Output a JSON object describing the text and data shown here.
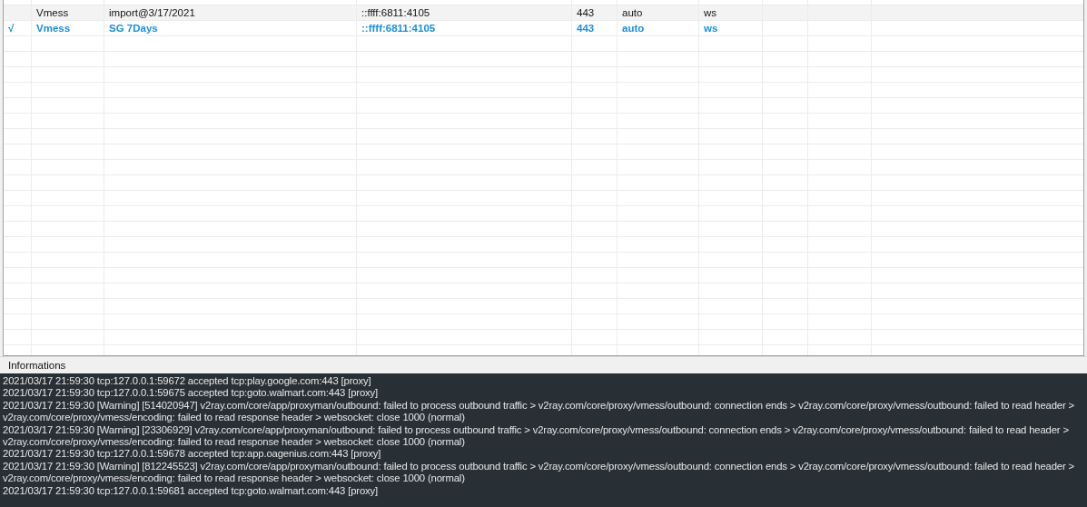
{
  "servers": {
    "rows": [
      {
        "selected": false,
        "hovered": true,
        "check": "",
        "type": "Vmess",
        "alias": "import@3/17/2021",
        "address": "::ffff:6811:4105",
        "port": "443",
        "security": "auto",
        "network": "ws"
      },
      {
        "selected": true,
        "hovered": false,
        "check": "√",
        "type": "Vmess",
        "alias": "SG 7Days",
        "address": "::ffff:6811:4105",
        "port": "443",
        "security": "auto",
        "network": "ws"
      }
    ]
  },
  "log_panel": {
    "title": "Informations",
    "entries": [
      "2021/03/17 21:59:30 tcp:127.0.0.1:59672 accepted tcp:play.google.com:443 [proxy]",
      "2021/03/17 21:59:30 tcp:127.0.0.1:59675 accepted tcp:goto.walmart.com:443 [proxy]",
      "2021/03/17 21:59:30 [Warning] [514020947] v2ray.com/core/app/proxyman/outbound: failed to process outbound traffic > v2ray.com/core/proxy/vmess/outbound: connection ends > v2ray.com/core/proxy/vmess/outbound: failed to read header > v2ray.com/core/proxy/vmess/encoding: failed to read response header > websocket: close 1000 (normal)",
      "2021/03/17 21:59:30 [Warning] [23306929] v2ray.com/core/app/proxyman/outbound: failed to process outbound traffic > v2ray.com/core/proxy/vmess/outbound: connection ends > v2ray.com/core/proxy/vmess/outbound: failed to read header > v2ray.com/core/proxy/vmess/encoding: failed to read response header > websocket: close 1000 (normal)",
      "2021/03/17 21:59:30 tcp:127.0.0.1:59678 accepted tcp:app.oagenius.com:443 [proxy]",
      "2021/03/17 21:59:30 [Warning] [812245523] v2ray.com/core/app/proxyman/outbound: failed to process outbound traffic > v2ray.com/core/proxy/vmess/outbound: connection ends > v2ray.com/core/proxy/vmess/outbound: failed to read header > v2ray.com/core/proxy/vmess/encoding: failed to read response header > websocket: close 1000 (normal)",
      "2021/03/17 21:59:30 tcp:127.0.0.1:59681 accepted tcp:goto.walmart.com:443 [proxy]"
    ]
  }
}
